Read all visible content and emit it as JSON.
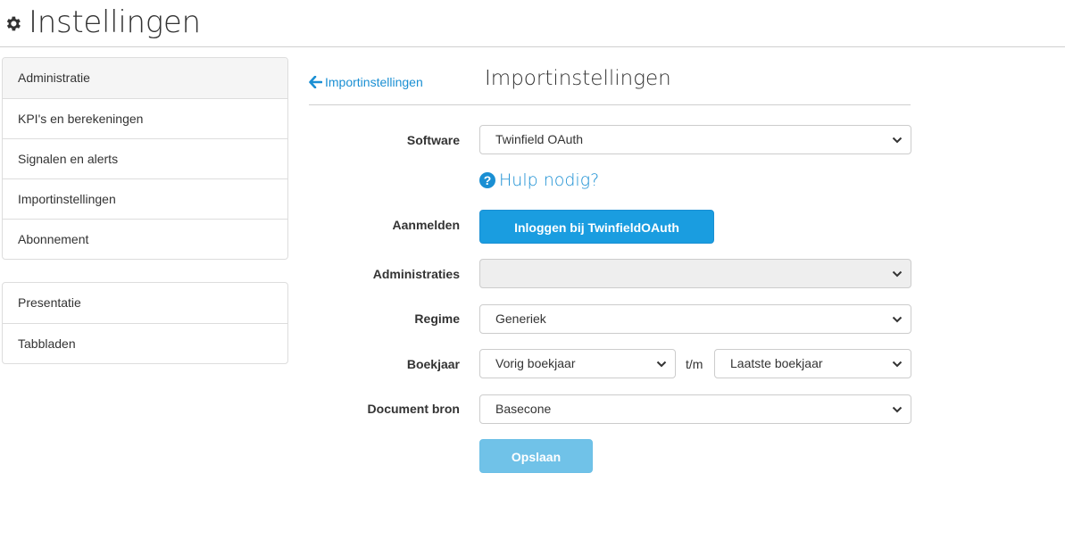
{
  "header": {
    "title": "Instellingen",
    "icon": "gear-icon"
  },
  "sidebar": {
    "group1": [
      {
        "label": "Administratie",
        "active": true
      },
      {
        "label": "KPI's en berekeningen"
      },
      {
        "label": "Signalen en alerts"
      },
      {
        "label": "Importinstellingen"
      },
      {
        "label": "Abonnement"
      }
    ],
    "group2": [
      {
        "label": "Presentatie"
      },
      {
        "label": "Tabbladen"
      }
    ]
  },
  "main": {
    "back_link": "Importinstellingen",
    "title": "Importinstellingen",
    "form": {
      "software": {
        "label": "Software",
        "value": "Twinfield OAuth"
      },
      "help_link": "Hulp nodig?",
      "aanmelden": {
        "label": "Aanmelden",
        "button": "Inloggen bij TwinfieldOAuth"
      },
      "administraties": {
        "label": "Administraties",
        "value": ""
      },
      "regime": {
        "label": "Regime",
        "value": "Generiek"
      },
      "boekjaar": {
        "label": "Boekjaar",
        "from": "Vorig boekjaar",
        "separator": "t/m",
        "to": "Laatste boekjaar"
      },
      "document_bron": {
        "label": "Document bron",
        "value": "Basecone"
      },
      "save_button": "Opslaan"
    }
  },
  "colors": {
    "accent": "#1a9de0",
    "link": "#1a8fd3",
    "save_disabled": "#70c2e8"
  }
}
